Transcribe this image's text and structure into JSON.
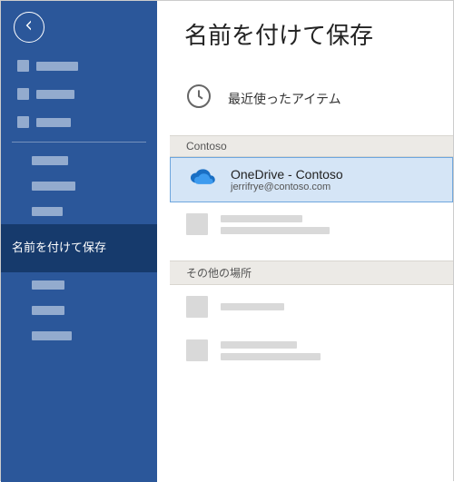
{
  "sidebar": {
    "active_label": "名前を付けて保存"
  },
  "page": {
    "title": "名前を付けて保存"
  },
  "recent": {
    "label": "最近使ったアイテム"
  },
  "sections": {
    "contoso": "Contoso",
    "other": "その他の場所"
  },
  "onedrive": {
    "title": "OneDrive - Contoso",
    "subtitle": "jerrifrye@contoso.com"
  }
}
